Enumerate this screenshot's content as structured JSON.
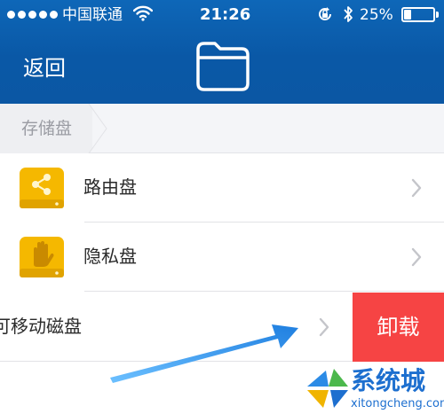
{
  "status_bar": {
    "carrier": "中国联通",
    "time": "21:26",
    "battery_percent": "25%",
    "battery_level": 0.25,
    "signal_bars": 5
  },
  "nav": {
    "back_label": "返回",
    "icon": "folder-icon"
  },
  "section": {
    "title": "存储盘"
  },
  "items": [
    {
      "label": "路由盘",
      "icon": "share-icon"
    },
    {
      "label": "隐私盘",
      "icon": "hand-icon"
    }
  ],
  "swiped_item": {
    "label": "可移动磁盘",
    "action_label": "卸载"
  },
  "watermark": {
    "brand": "系统城",
    "url": "xitongcheng.com"
  },
  "colors": {
    "header": "#0b5aa8",
    "danger": "#f64444",
    "drive": "#f5b800",
    "arrow": "#2f8fe6"
  }
}
